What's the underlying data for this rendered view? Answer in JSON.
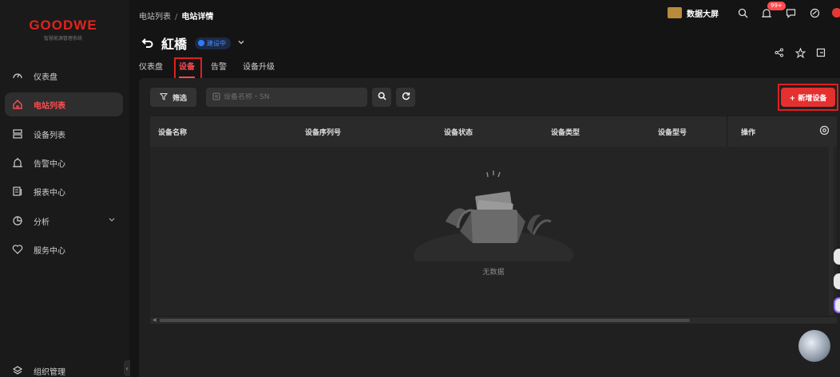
{
  "app": {
    "logo_text": "GOODWE",
    "logo_subtitle": "智慧能源管理系统"
  },
  "sidebar": {
    "items": [
      {
        "label": "仪表盘",
        "icon": "dashboard-icon"
      },
      {
        "label": "电站列表",
        "icon": "station-icon",
        "active": true
      },
      {
        "label": "设备列表",
        "icon": "device-list-icon"
      },
      {
        "label": "告警中心",
        "icon": "alarm-icon"
      },
      {
        "label": "报表中心",
        "icon": "report-icon"
      },
      {
        "label": "分析",
        "icon": "analysis-icon"
      },
      {
        "label": "服务中心",
        "icon": "service-icon"
      }
    ],
    "bottom_item": {
      "label": "组织管理",
      "icon": "organization-icon"
    }
  },
  "header": {
    "breadcrumb": [
      "电站列表",
      "电站详情"
    ],
    "station_name": "紅橋",
    "status_badge": "建设中",
    "tabs": [
      {
        "label": "仪表盘"
      },
      {
        "label": "设备",
        "active": true
      },
      {
        "label": "告警"
      },
      {
        "label": "设备升级"
      }
    ],
    "big_screen_label": "数据大屏",
    "notification_count": "99+"
  },
  "toolbar": {
    "filter_label": "筛选",
    "search_placeholder": "设备名称・SN",
    "add_button_label": "+ 新增设备"
  },
  "table": {
    "columns": [
      "设备名称",
      "设备序列号",
      "设备状态",
      "设备类型",
      "设备型号",
      "操作"
    ],
    "empty_text": "无数据"
  },
  "colors": {
    "accent": "#ff4d4f",
    "brand": "#e2231a",
    "status_blue": "#2f7bff",
    "background": "#141414"
  }
}
